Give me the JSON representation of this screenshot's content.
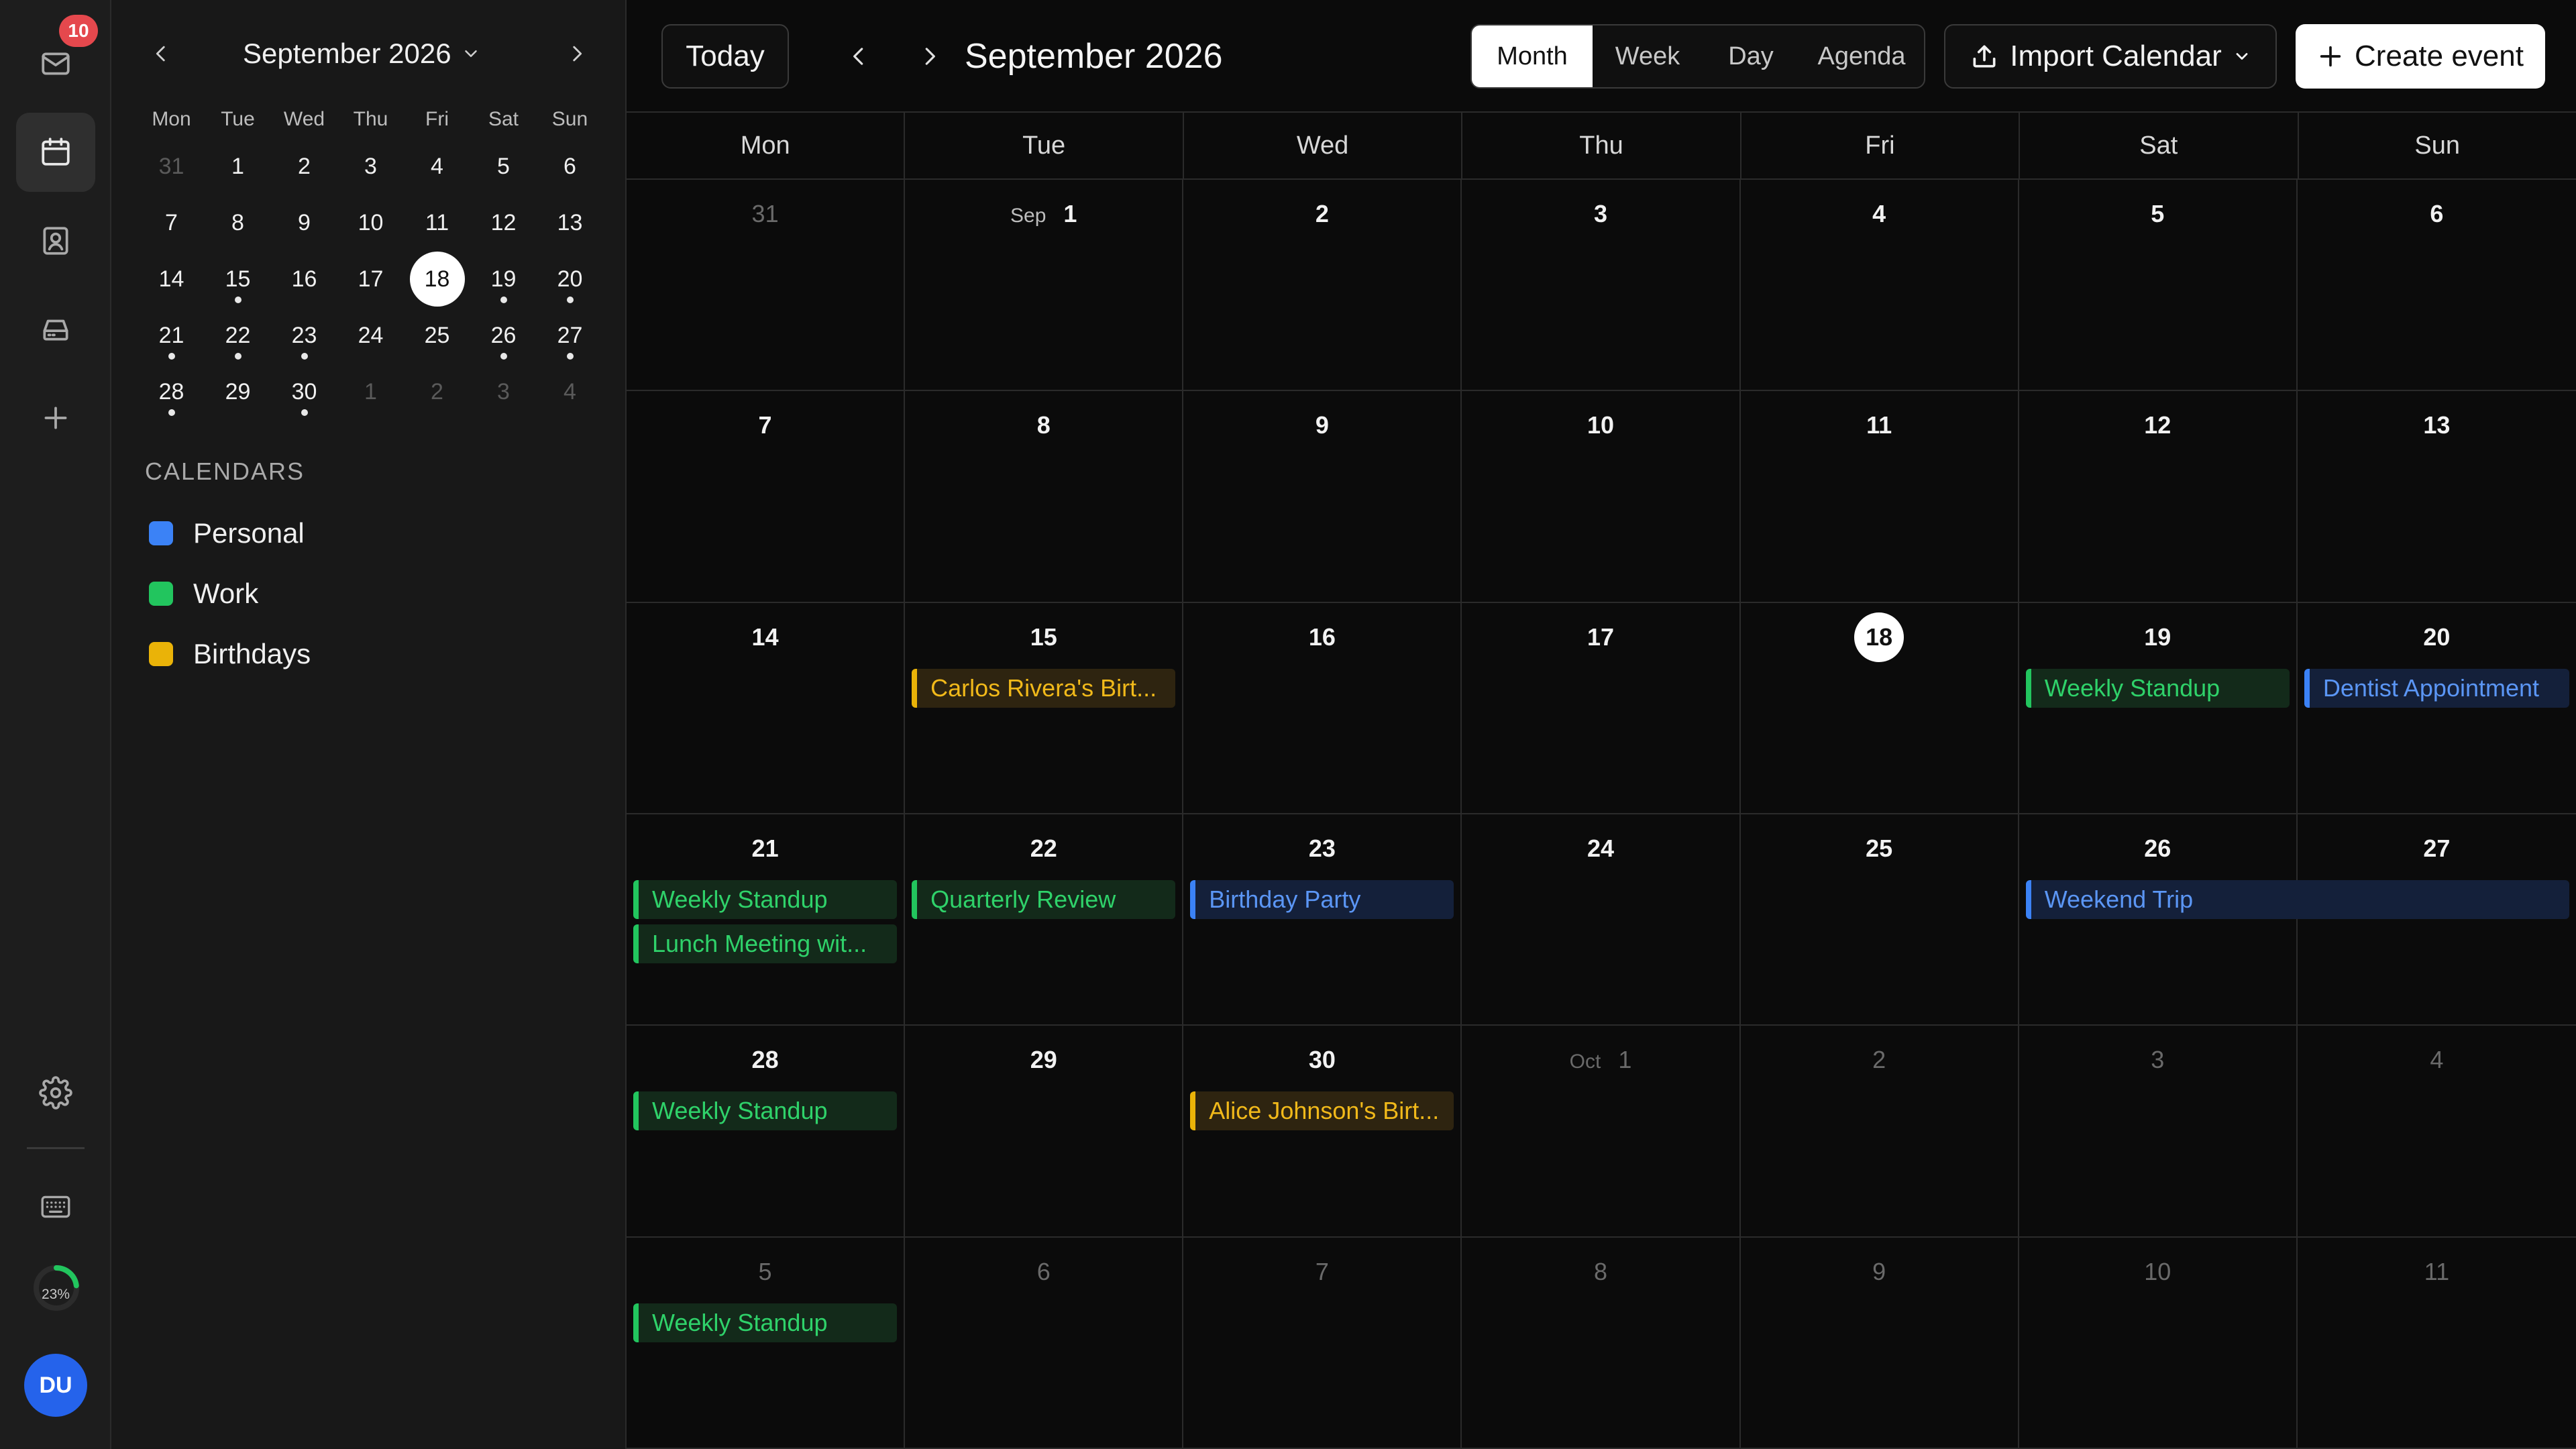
{
  "rail": {
    "mail_badge": "10",
    "progress_label": "23%",
    "progress_value": 0.23,
    "avatar_initials": "DU",
    "icons": [
      "mail-icon",
      "calendar-icon",
      "contacts-icon",
      "inbox-tray-icon",
      "plus-icon",
      "gear-icon",
      "keyboard-icon"
    ]
  },
  "mini_calendar": {
    "title": "September 2026",
    "weekdays": [
      "Mon",
      "Tue",
      "Wed",
      "Thu",
      "Fri",
      "Sat",
      "Sun"
    ],
    "days": [
      {
        "d": "31",
        "out": true
      },
      {
        "d": "1"
      },
      {
        "d": "2"
      },
      {
        "d": "3"
      },
      {
        "d": "4"
      },
      {
        "d": "5"
      },
      {
        "d": "6"
      },
      {
        "d": "7"
      },
      {
        "d": "8"
      },
      {
        "d": "9"
      },
      {
        "d": "10"
      },
      {
        "d": "11"
      },
      {
        "d": "12"
      },
      {
        "d": "13"
      },
      {
        "d": "14"
      },
      {
        "d": "15",
        "dot": true
      },
      {
        "d": "16"
      },
      {
        "d": "17"
      },
      {
        "d": "18",
        "today": true
      },
      {
        "d": "19",
        "dot": true
      },
      {
        "d": "20",
        "dot": true
      },
      {
        "d": "21",
        "dot": true
      },
      {
        "d": "22",
        "dot": true
      },
      {
        "d": "23",
        "dot": true
      },
      {
        "d": "24"
      },
      {
        "d": "25"
      },
      {
        "d": "26",
        "dot": true
      },
      {
        "d": "27",
        "dot": true
      },
      {
        "d": "28",
        "dot": true
      },
      {
        "d": "29"
      },
      {
        "d": "30",
        "dot": true
      },
      {
        "d": "1",
        "out": true
      },
      {
        "d": "2",
        "out": true
      },
      {
        "d": "3",
        "out": true
      },
      {
        "d": "4",
        "out": true
      }
    ]
  },
  "calendars": {
    "heading": "CALENDARS",
    "items": [
      {
        "label": "Personal",
        "color": "#3b82f6"
      },
      {
        "label": "Work",
        "color": "#22c55e"
      },
      {
        "label": "Birthdays",
        "color": "#eab308"
      }
    ]
  },
  "toolbar": {
    "today_label": "Today",
    "title": "September 2026",
    "views": [
      "Month",
      "Week",
      "Day",
      "Agenda"
    ],
    "active_view": "Month",
    "import_label": "Import Calendar",
    "create_label": "Create event"
  },
  "month": {
    "weekdays": [
      "Mon",
      "Tue",
      "Wed",
      "Thu",
      "Fri",
      "Sat",
      "Sun"
    ],
    "cells": [
      {
        "d": "31",
        "out": true
      },
      {
        "d": "1",
        "month_label": "Sep"
      },
      {
        "d": "2"
      },
      {
        "d": "3"
      },
      {
        "d": "4"
      },
      {
        "d": "5"
      },
      {
        "d": "6"
      },
      {
        "d": "7"
      },
      {
        "d": "8"
      },
      {
        "d": "9"
      },
      {
        "d": "10"
      },
      {
        "d": "11"
      },
      {
        "d": "12"
      },
      {
        "d": "13"
      },
      {
        "d": "14"
      },
      {
        "d": "15",
        "events": [
          {
            "title": "Carlos Rivera's Birt...",
            "cal": "birthday"
          }
        ]
      },
      {
        "d": "16"
      },
      {
        "d": "17"
      },
      {
        "d": "18",
        "today": true
      },
      {
        "d": "19",
        "events": [
          {
            "title": "Weekly Standup",
            "cal": "work"
          }
        ]
      },
      {
        "d": "20",
        "events": [
          {
            "title": "Dentist Appointment",
            "cal": "personal"
          }
        ]
      },
      {
        "d": "21",
        "events": [
          {
            "title": "Weekly Standup",
            "cal": "work"
          },
          {
            "title": "Lunch Meeting wit...",
            "cal": "work"
          }
        ]
      },
      {
        "d": "22",
        "events": [
          {
            "title": "Quarterly Review",
            "cal": "work"
          }
        ]
      },
      {
        "d": "23",
        "events": [
          {
            "title": "Birthday Party",
            "cal": "personal"
          }
        ]
      },
      {
        "d": "24"
      },
      {
        "d": "25"
      },
      {
        "d": "26",
        "events": [
          {
            "title": "Weekend Trip",
            "cal": "personal",
            "span": 2
          }
        ]
      },
      {
        "d": "27"
      },
      {
        "d": "28",
        "events": [
          {
            "title": "Weekly Standup",
            "cal": "work"
          }
        ]
      },
      {
        "d": "29"
      },
      {
        "d": "30",
        "events": [
          {
            "title": "Alice Johnson's Birt...",
            "cal": "birthday"
          }
        ]
      },
      {
        "d": "1",
        "out": true,
        "month_label": "Oct"
      },
      {
        "d": "2",
        "out": true
      },
      {
        "d": "3",
        "out": true
      },
      {
        "d": "4",
        "out": true
      },
      {
        "d": "5",
        "out": true,
        "events": [
          {
            "title": "Weekly Standup",
            "cal": "work"
          }
        ]
      },
      {
        "d": "6",
        "out": true
      },
      {
        "d": "7",
        "out": true
      },
      {
        "d": "8",
        "out": true
      },
      {
        "d": "9",
        "out": true
      },
      {
        "d": "10",
        "out": true
      },
      {
        "d": "11",
        "out": true
      }
    ]
  }
}
